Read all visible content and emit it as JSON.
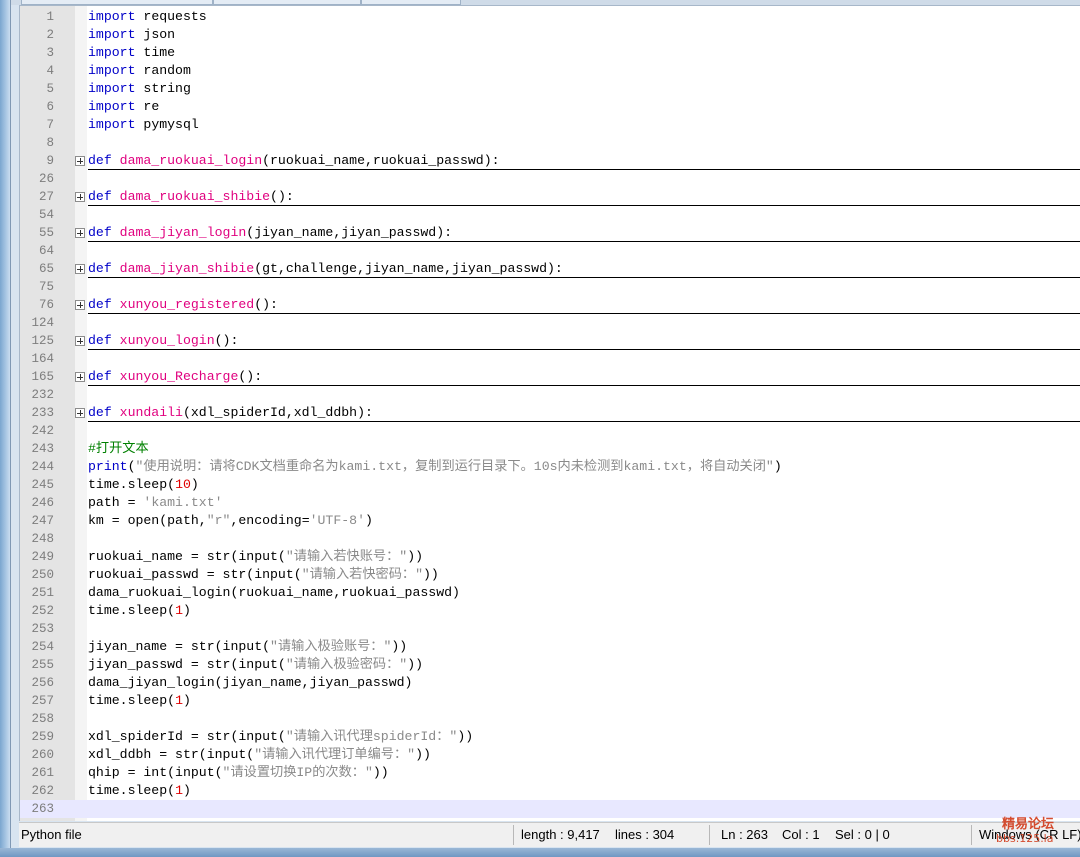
{
  "editor": {
    "lines": [
      {
        "ln": "1",
        "parts": [
          [
            "kw",
            "import"
          ],
          [
            "",
            "requests"
          ]
        ]
      },
      {
        "ln": "2",
        "parts": [
          [
            "kw",
            "import"
          ],
          [
            "",
            "json"
          ]
        ]
      },
      {
        "ln": "3",
        "parts": [
          [
            "kw",
            "import"
          ],
          [
            "",
            "time"
          ]
        ]
      },
      {
        "ln": "4",
        "parts": [
          [
            "kw",
            "import"
          ],
          [
            "",
            "random"
          ]
        ]
      },
      {
        "ln": "5",
        "parts": [
          [
            "kw",
            "import"
          ],
          [
            "",
            "string"
          ]
        ]
      },
      {
        "ln": "6",
        "parts": [
          [
            "kw",
            "import"
          ],
          [
            "",
            "re"
          ]
        ]
      },
      {
        "ln": "7",
        "parts": [
          [
            "kw",
            "import"
          ],
          [
            "",
            "pymysql"
          ]
        ]
      },
      {
        "ln": "8",
        "parts": []
      },
      {
        "ln": "9",
        "fold": true,
        "parts": [
          [
            "kw",
            "def"
          ],
          [
            "fn",
            "dama_ruokuai_login"
          ],
          [
            "",
            "(ruokuai_name,ruokuai_passwd):"
          ]
        ]
      },
      {
        "ln": "26",
        "parts": []
      },
      {
        "ln": "27",
        "fold": true,
        "parts": [
          [
            "kw",
            "def"
          ],
          [
            "fn",
            "dama_ruokuai_shibie"
          ],
          [
            "",
            "():"
          ]
        ]
      },
      {
        "ln": "54",
        "parts": []
      },
      {
        "ln": "55",
        "fold": true,
        "parts": [
          [
            "kw",
            "def"
          ],
          [
            "fn",
            "dama_jiyan_login"
          ],
          [
            "",
            "(jiyan_name,jiyan_passwd):"
          ]
        ]
      },
      {
        "ln": "64",
        "parts": []
      },
      {
        "ln": "65",
        "fold": true,
        "parts": [
          [
            "kw",
            "def"
          ],
          [
            "fn",
            "dama_jiyan_shibie"
          ],
          [
            "",
            "(gt,challenge,jiyan_name,jiyan_passwd):"
          ]
        ]
      },
      {
        "ln": "75",
        "parts": []
      },
      {
        "ln": "76",
        "fold": true,
        "parts": [
          [
            "kw",
            "def"
          ],
          [
            "fn",
            "xunyou_registered"
          ],
          [
            "",
            "():"
          ]
        ]
      },
      {
        "ln": "124",
        "parts": []
      },
      {
        "ln": "125",
        "fold": true,
        "parts": [
          [
            "kw",
            "def"
          ],
          [
            "fn",
            "xunyou_login"
          ],
          [
            "",
            "():"
          ]
        ]
      },
      {
        "ln": "164",
        "parts": []
      },
      {
        "ln": "165",
        "fold": true,
        "parts": [
          [
            "kw",
            "def"
          ],
          [
            "fn",
            "xunyou_Recharge"
          ],
          [
            "",
            "():"
          ]
        ]
      },
      {
        "ln": "232",
        "parts": []
      },
      {
        "ln": "233",
        "fold": true,
        "parts": [
          [
            "kw",
            "def"
          ],
          [
            "fn",
            "xundaili"
          ],
          [
            "",
            "(xdl_spiderId,xdl_ddbh):"
          ]
        ]
      },
      {
        "ln": "242",
        "parts": []
      },
      {
        "ln": "243",
        "parts": [
          [
            "cmt",
            "#打开文本"
          ]
        ]
      },
      {
        "ln": "244",
        "parts": [
          [
            "kw",
            "print"
          ],
          [
            "",
            "("
          ],
          [
            "str",
            "\"使用说明：请将CDK文档重命名为kami.txt，复制到运行目录下。10s内未检测到kami.txt，将自动关闭\""
          ],
          [
            "",
            ")"
          ]
        ]
      },
      {
        "ln": "245",
        "parts": [
          [
            "",
            "time.sleep("
          ],
          [
            "num",
            "10"
          ],
          [
            "",
            ")"
          ]
        ]
      },
      {
        "ln": "246",
        "parts": [
          [
            "",
            "path = "
          ],
          [
            "str",
            "'kami.txt'"
          ]
        ]
      },
      {
        "ln": "247",
        "parts": [
          [
            "",
            "km = open(path,"
          ],
          [
            "str",
            "\"r\""
          ],
          [
            "",
            ",encoding="
          ],
          [
            "str",
            "'UTF-8'"
          ],
          [
            "",
            ")"
          ]
        ]
      },
      {
        "ln": "248",
        "parts": []
      },
      {
        "ln": "249",
        "parts": [
          [
            "",
            "ruokuai_name = str(input("
          ],
          [
            "str",
            "\"请输入若快账号：\""
          ],
          [
            "",
            "))"
          ]
        ]
      },
      {
        "ln": "250",
        "parts": [
          [
            "",
            "ruokuai_passwd = str(input("
          ],
          [
            "str",
            "\"请输入若快密码：\""
          ],
          [
            "",
            "))"
          ]
        ]
      },
      {
        "ln": "251",
        "parts": [
          [
            "",
            "dama_ruokuai_login(ruokuai_name,ruokuai_passwd)"
          ]
        ]
      },
      {
        "ln": "252",
        "parts": [
          [
            "",
            "time.sleep("
          ],
          [
            "num",
            "1"
          ],
          [
            "",
            ")"
          ]
        ]
      },
      {
        "ln": "253",
        "parts": []
      },
      {
        "ln": "254",
        "parts": [
          [
            "",
            "jiyan_name = str(input("
          ],
          [
            "str",
            "\"请输入极验账号：\""
          ],
          [
            "",
            "))"
          ]
        ]
      },
      {
        "ln": "255",
        "parts": [
          [
            "",
            "jiyan_passwd = str(input("
          ],
          [
            "str",
            "\"请输入极验密码：\""
          ],
          [
            "",
            "))"
          ]
        ]
      },
      {
        "ln": "256",
        "parts": [
          [
            "",
            "dama_jiyan_login(jiyan_name,jiyan_passwd)"
          ]
        ]
      },
      {
        "ln": "257",
        "parts": [
          [
            "",
            "time.sleep("
          ],
          [
            "num",
            "1"
          ],
          [
            "",
            ")"
          ]
        ]
      },
      {
        "ln": "258",
        "parts": []
      },
      {
        "ln": "259",
        "parts": [
          [
            "",
            "xdl_spiderId = str(input("
          ],
          [
            "str",
            "\"请输入讯代理spiderId：\""
          ],
          [
            "",
            "))"
          ]
        ]
      },
      {
        "ln": "260",
        "parts": [
          [
            "",
            "xdl_ddbh = str(input("
          ],
          [
            "str",
            "\"请输入讯代理订单编号：\""
          ],
          [
            "",
            "))"
          ]
        ]
      },
      {
        "ln": "261",
        "parts": [
          [
            "",
            "qhip = int(input("
          ],
          [
            "str",
            "\"请设置切换IP的次数：\""
          ],
          [
            "",
            "))"
          ]
        ]
      },
      {
        "ln": "262",
        "parts": [
          [
            "",
            "time.sleep("
          ],
          [
            "num",
            "1"
          ],
          [
            "",
            ")"
          ]
        ]
      },
      {
        "ln": "263",
        "current": true,
        "parts": []
      }
    ]
  },
  "statusbar": {
    "file_type": "Python file",
    "length": "length : 9,417",
    "lines": "lines : 304",
    "ln": "Ln : 263",
    "col": "Col : 1",
    "sel": "Sel : 0 | 0",
    "eol": "Windows (CR LF)"
  },
  "watermark": {
    "line1": "精易论坛",
    "line2": "bbs.125.la"
  },
  "colors": {
    "keyword": "#0000c8",
    "function_name": "#e0007f",
    "comment": "#008000",
    "string": "#8a8a8a",
    "number": "#e00000",
    "current_line": "#e8e8ff"
  }
}
